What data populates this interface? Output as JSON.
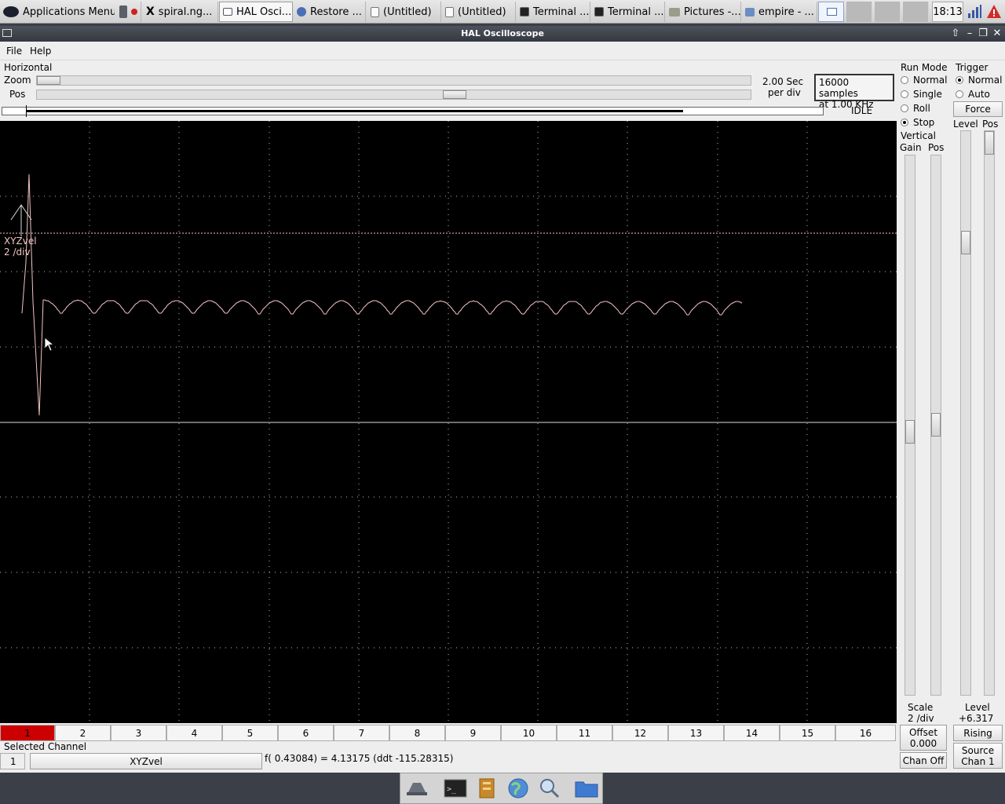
{
  "taskbar": {
    "apps_menu": "Applications Menu",
    "tasks": [
      "spiral.ng...",
      "HAL Osci...",
      "Restore ...",
      "(Untitled)",
      "(Untitled)",
      "Terminal ...",
      "Terminal ...",
      "Pictures -...",
      "empire - ..."
    ],
    "clock": "18:13",
    "icons": [
      "xfce-mouse-icon",
      "logout-icon",
      "network-icon",
      "warning-icon"
    ]
  },
  "window": {
    "title": "HAL Oscilloscope",
    "menu": {
      "file": "File",
      "help": "Help"
    }
  },
  "horizontal": {
    "title": "Horizontal",
    "zoom_label": "Zoom",
    "pos_label": "Pos",
    "zoom_value": 0.0,
    "pos_value": 0.58,
    "rate_line1": "2.00 Sec",
    "rate_line2": "per div",
    "samples_line1": "16000 samples",
    "samples_line2": "at 1.00 KHz",
    "status": "IDLE"
  },
  "run_mode": {
    "title": "Run Mode",
    "options": [
      "Normal",
      "Single",
      "Roll",
      "Stop"
    ],
    "selected": "Stop"
  },
  "trigger": {
    "title": "Trigger",
    "options": [
      "Normal",
      "Auto"
    ],
    "selected": "Normal",
    "force": "Force",
    "level_label": "Level",
    "pos_label": "Pos",
    "level_caption": "Level",
    "level_value": "+6.317",
    "edge": "Rising",
    "source_line1": "Source",
    "source_line2": "Chan  1"
  },
  "vertical": {
    "title": "Vertical",
    "gain_label": "Gain",
    "pos_label": "Pos",
    "scale_label": "Scale",
    "scale_value": "2 /div",
    "offset_label": "Offset",
    "offset_value": "0.000",
    "chan_off": "Chan Off"
  },
  "trace": {
    "name": "XYZvel",
    "scale": "2 /div",
    "color": "#f2c4c4"
  },
  "channels": [
    "1",
    "2",
    "3",
    "4",
    "5",
    "6",
    "7",
    "8",
    "9",
    "10",
    "11",
    "12",
    "13",
    "14",
    "15",
    "16"
  ],
  "selected_channel": {
    "title": "Selected Channel",
    "number": "1",
    "name": "XYZvel",
    "readout": "f( 0.43084) =  4.13175 (ddt -115.28315)"
  },
  "colors": {
    "selected_channel": "#cc0000",
    "scope_bg": "#000000",
    "grid": "#bbbbbb"
  },
  "dock": [
    "file-manager-icon",
    "terminal-icon",
    "files-icon",
    "web-browser-icon",
    "search-icon",
    "folder-icon"
  ]
}
